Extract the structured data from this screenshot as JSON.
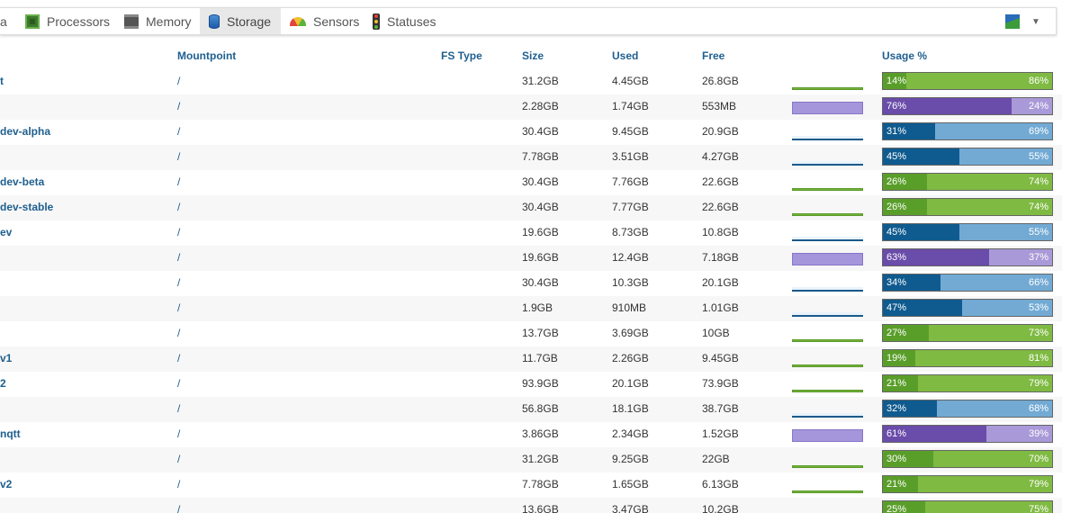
{
  "tabs": [
    {
      "label": "a",
      "icon": "",
      "active": false
    },
    {
      "label": "Processors",
      "icon": "cpu-icon",
      "active": false
    },
    {
      "label": "Memory",
      "icon": "memory-icon",
      "active": false
    },
    {
      "label": "Storage",
      "icon": "disk-icon",
      "active": true
    },
    {
      "label": "Sensors",
      "icon": "gauge-icon",
      "active": false
    },
    {
      "label": "Statuses",
      "icon": "traffic-light-icon",
      "active": false
    }
  ],
  "account": {
    "icon": "account-icon",
    "caret": "▼"
  },
  "columns": {
    "name": "",
    "mountpoint": "Mountpoint",
    "fstype": "FS Type",
    "size": "Size",
    "used": "Used",
    "free": "Free",
    "usage": "Usage %"
  },
  "colors": {
    "green_used": "#5a9e2a",
    "green_free": "#7fba42",
    "blue_used": "#0f5b8f",
    "blue_free": "#72aad4",
    "purple_used": "#6a4caa",
    "purple_free": "#a999d8"
  },
  "rows": [
    {
      "name": "t",
      "mount": "/",
      "size": "31.2GB",
      "used": "4.45GB",
      "free": "26.8GB",
      "usage_used": "14%",
      "usage_free": "86%",
      "pct": 14,
      "color": "green",
      "spark": "line-green"
    },
    {
      "name": "",
      "mount": "/",
      "size": "2.28GB",
      "used": "1.74GB",
      "free": "553MB",
      "usage_used": "76%",
      "usage_free": "24%",
      "pct": 76,
      "color": "purple",
      "spark": "tall"
    },
    {
      "name": "dev-alpha",
      "mount": "/",
      "size": "30.4GB",
      "used": "9.45GB",
      "free": "20.9GB",
      "usage_used": "31%",
      "usage_free": "69%",
      "pct": 31,
      "color": "blue",
      "spark": "line-blue"
    },
    {
      "name": "",
      "mount": "/",
      "size": "7.78GB",
      "used": "3.51GB",
      "free": "4.27GB",
      "usage_used": "45%",
      "usage_free": "55%",
      "pct": 45,
      "color": "blue",
      "spark": "line-blue"
    },
    {
      "name": "dev-beta",
      "mount": "/",
      "size": "30.4GB",
      "used": "7.76GB",
      "free": "22.6GB",
      "usage_used": "26%",
      "usage_free": "74%",
      "pct": 26,
      "color": "green",
      "spark": "line-green"
    },
    {
      "name": "dev-stable",
      "mount": "/",
      "size": "30.4GB",
      "used": "7.77GB",
      "free": "22.6GB",
      "usage_used": "26%",
      "usage_free": "74%",
      "pct": 26,
      "color": "green",
      "spark": "line-green"
    },
    {
      "name": "ev",
      "mount": "/",
      "size": "19.6GB",
      "used": "8.73GB",
      "free": "10.8GB",
      "usage_used": "45%",
      "usage_free": "55%",
      "pct": 45,
      "color": "blue",
      "spark": "line-blue"
    },
    {
      "name": "",
      "mount": "/",
      "size": "19.6GB",
      "used": "12.4GB",
      "free": "7.18GB",
      "usage_used": "63%",
      "usage_free": "37%",
      "pct": 63,
      "color": "purple",
      "spark": "tall"
    },
    {
      "name": "",
      "mount": "/",
      "size": "30.4GB",
      "used": "10.3GB",
      "free": "20.1GB",
      "usage_used": "34%",
      "usage_free": "66%",
      "pct": 34,
      "color": "blue",
      "spark": "line-blue"
    },
    {
      "name": "",
      "mount": "/",
      "size": "1.9GB",
      "used": "910MB",
      "free": "1.01GB",
      "usage_used": "47%",
      "usage_free": "53%",
      "pct": 47,
      "color": "blue",
      "spark": "line-blue"
    },
    {
      "name": "",
      "mount": "/",
      "size": "13.7GB",
      "used": "3.69GB",
      "free": "10GB",
      "usage_used": "27%",
      "usage_free": "73%",
      "pct": 27,
      "color": "green",
      "spark": "line-green"
    },
    {
      "name": "v1",
      "mount": "/",
      "size": "11.7GB",
      "used": "2.26GB",
      "free": "9.45GB",
      "usage_used": "19%",
      "usage_free": "81%",
      "pct": 19,
      "color": "green",
      "spark": "line-green"
    },
    {
      "name": "2",
      "mount": "/",
      "size": "93.9GB",
      "used": "20.1GB",
      "free": "73.9GB",
      "usage_used": "21%",
      "usage_free": "79%",
      "pct": 21,
      "color": "green",
      "spark": "line-green"
    },
    {
      "name": "",
      "mount": "/",
      "size": "56.8GB",
      "used": "18.1GB",
      "free": "38.7GB",
      "usage_used": "32%",
      "usage_free": "68%",
      "pct": 32,
      "color": "blue",
      "spark": "line-blue"
    },
    {
      "name": "nqtt",
      "mount": "/",
      "size": "3.86GB",
      "used": "2.34GB",
      "free": "1.52GB",
      "usage_used": "61%",
      "usage_free": "39%",
      "pct": 61,
      "color": "purple",
      "spark": "tall"
    },
    {
      "name": "",
      "mount": "/",
      "size": "31.2GB",
      "used": "9.25GB",
      "free": "22GB",
      "usage_used": "30%",
      "usage_free": "70%",
      "pct": 30,
      "color": "green",
      "spark": "line-green"
    },
    {
      "name": "v2",
      "mount": "/",
      "size": "7.78GB",
      "used": "1.65GB",
      "free": "6.13GB",
      "usage_used": "21%",
      "usage_free": "79%",
      "pct": 21,
      "color": "green",
      "spark": "line-green"
    },
    {
      "name": "",
      "mount": "/",
      "size": "13.6GB",
      "used": "3.47GB",
      "free": "10.2GB",
      "usage_used": "25%",
      "usage_free": "75%",
      "pct": 25,
      "color": "green",
      "spark": "line-green"
    }
  ]
}
